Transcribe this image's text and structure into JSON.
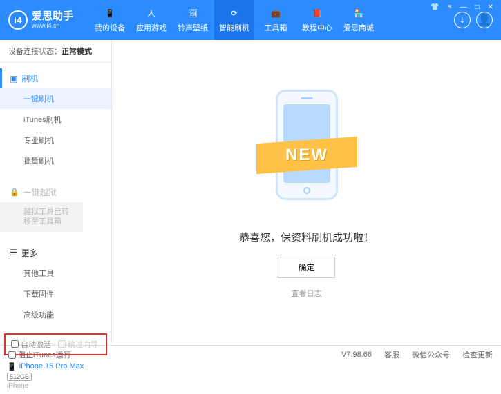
{
  "header": {
    "logo_text": "爱思助手",
    "logo_sub": "www.i4.cn",
    "nav": [
      {
        "label": "我的设备"
      },
      {
        "label": "应用游戏"
      },
      {
        "label": "铃声壁纸"
      },
      {
        "label": "智能刷机"
      },
      {
        "label": "工具箱"
      },
      {
        "label": "教程中心"
      },
      {
        "label": "爱思商城"
      }
    ]
  },
  "status": {
    "label": "设备连接状态：",
    "value": "正常模式"
  },
  "sidebar": {
    "flash": {
      "title": "刷机",
      "items": [
        {
          "label": "一键刷机",
          "active": true
        },
        {
          "label": "iTunes刷机"
        },
        {
          "label": "专业刷机"
        },
        {
          "label": "批量刷机"
        }
      ]
    },
    "jailbreak": {
      "title": "一键越狱",
      "note": "越狱工具已转移至工具箱"
    },
    "more": {
      "title": "更多",
      "items": [
        {
          "label": "其他工具"
        },
        {
          "label": "下载固件"
        },
        {
          "label": "高级功能"
        }
      ]
    },
    "checkboxes": {
      "auto_activate": "自动激活",
      "skip_guide": "跳过向导"
    },
    "device": {
      "name": "iPhone 15 Pro Max",
      "storage": "512GB",
      "type": "iPhone"
    }
  },
  "main": {
    "ribbon": "NEW",
    "success": "恭喜您，保资料刷机成功啦！",
    "ok": "确定",
    "view_log": "查看日志"
  },
  "footer": {
    "block_itunes": "阻止iTunes运行",
    "version": "V7.98.66",
    "links": [
      "客服",
      "微信公众号",
      "检查更新"
    ]
  }
}
